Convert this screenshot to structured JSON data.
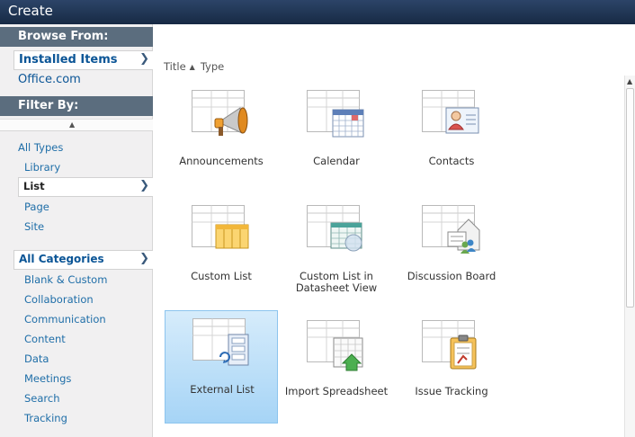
{
  "window": {
    "title": "Create"
  },
  "browse": {
    "heading": "Browse From:",
    "items": [
      {
        "label": "Installed Items",
        "selected": true
      },
      {
        "label": "Office.com",
        "selected": false
      }
    ]
  },
  "filter": {
    "heading": "Filter By:",
    "types": [
      {
        "label": "All Types",
        "level": 0,
        "selected": false
      },
      {
        "label": "Library",
        "level": 1,
        "selected": false
      },
      {
        "label": "List",
        "level": 1,
        "selected": true
      },
      {
        "label": "Page",
        "level": 1,
        "selected": false
      },
      {
        "label": "Site",
        "level": 1,
        "selected": false
      }
    ],
    "categories": [
      {
        "label": "All Categories",
        "selected": true
      },
      {
        "label": "Blank & Custom"
      },
      {
        "label": "Collaboration"
      },
      {
        "label": "Communication"
      },
      {
        "label": "Content"
      },
      {
        "label": "Data"
      },
      {
        "label": "Meetings"
      },
      {
        "label": "Search"
      },
      {
        "label": "Tracking"
      }
    ]
  },
  "sort": {
    "title_label": "Title",
    "type_label": "Type",
    "direction": "ascending"
  },
  "templates": [
    {
      "label": "Announcements",
      "icon": "announcements-icon",
      "selected": false
    },
    {
      "label": "Calendar",
      "icon": "calendar-icon",
      "selected": false
    },
    {
      "label": "Contacts",
      "icon": "contacts-icon",
      "selected": false
    },
    {
      "label": "Custom List",
      "icon": "custom-list-icon",
      "selected": false
    },
    {
      "label": "Custom List in Datasheet View",
      "icon": "datasheet-icon",
      "selected": false
    },
    {
      "label": "Discussion Board",
      "icon": "discussion-board-icon",
      "selected": false
    },
    {
      "label": "External List",
      "icon": "external-list-icon",
      "selected": true
    },
    {
      "label": "Import Spreadsheet",
      "icon": "import-spreadsheet-icon",
      "selected": false
    },
    {
      "label": "Issue Tracking",
      "icon": "issue-tracking-icon",
      "selected": false
    }
  ],
  "colors": {
    "titlebar": "#1f3350",
    "section_header": "#5b6d7e",
    "link": "#0b5596",
    "selection": "#a6d4f6"
  }
}
